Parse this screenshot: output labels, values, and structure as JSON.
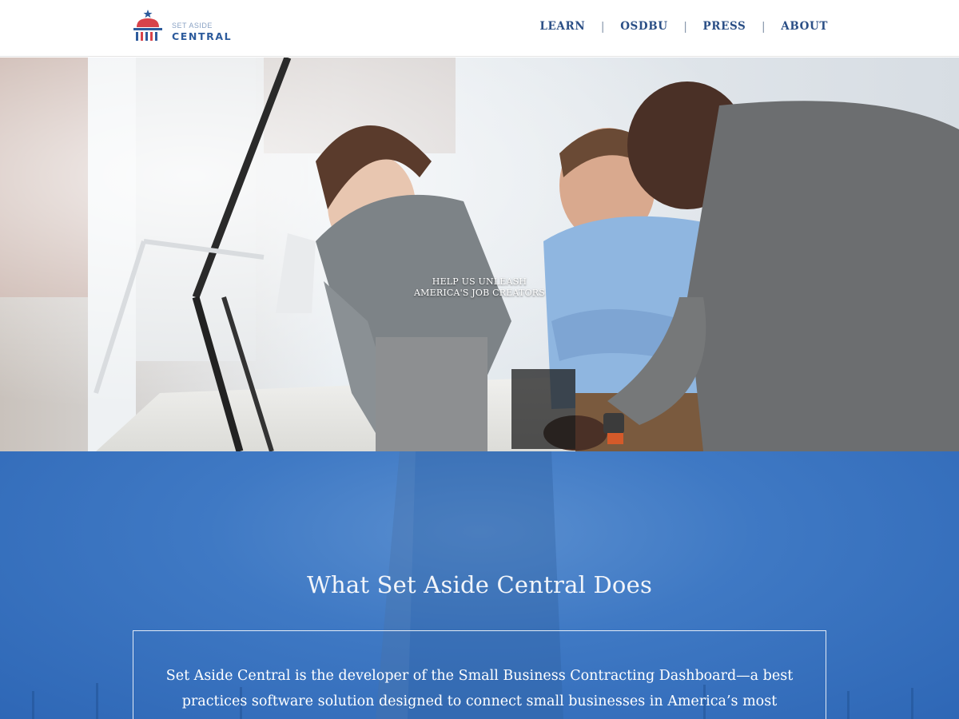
{
  "brand": {
    "small": "SET ASIDE",
    "big": "CENTRAL",
    "colors": {
      "red": "#d8434a",
      "blue": "#2d5b9c"
    }
  },
  "nav": {
    "items": [
      {
        "label": "LEARN"
      },
      {
        "label": "OSDBU"
      },
      {
        "label": "PRESS"
      },
      {
        "label": "ABOUT"
      }
    ],
    "separator": "|"
  },
  "hero": {
    "tagline_line1": "HELP US UNLEASH",
    "tagline_line2": "AMERICA'S JOB CREATORS"
  },
  "about": {
    "title": "What Set Aside Central Does",
    "description": "Set Aside Central is the developer of the Small Business Contracting Dashboard—a best practices software solution designed to connect small businesses in America’s most vulnerable areas gain"
  },
  "icons": [
    "capitol-dome-logo-icon"
  ],
  "colors": {
    "nav_text": "#2b4f86",
    "section_blue": "#3f79c4"
  }
}
